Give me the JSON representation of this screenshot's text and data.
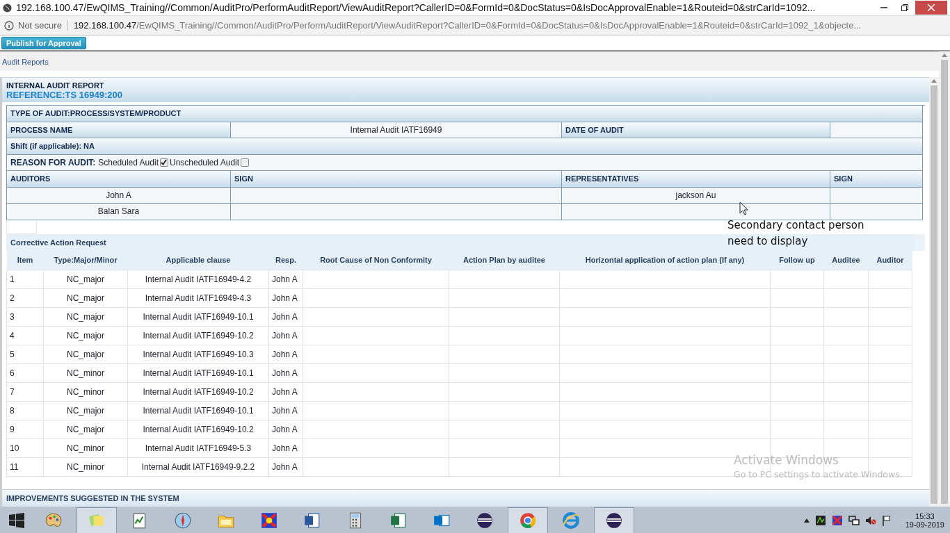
{
  "window": {
    "title": "192.168.100.47/EwQIMS_Training//Common/AuditPro/PerformAuditReport/ViewAuditReport?CallerID=0&FormId=0&DocStatus=0&IsDocApprovalEnable=1&Routeid=0&strCarId=1092..."
  },
  "address_bar": {
    "security": "Not secure",
    "host": "192.168.100.47",
    "path": "/EwQIMS_Training//Common/AuditPro/PerformAuditReport/ViewAuditReport?CallerID=0&FormId=0&DocStatus=0&IsDocApprovalEnable=1&Routeid=0&strCarId=1092_1&objecte..."
  },
  "toolbar": {
    "button": "Publish for Approval"
  },
  "breadcrumb": "Audit Reports",
  "report": {
    "title": "INTERNAL AUDIT REPORT",
    "reference": "REFERENCE:TS 16949:200",
    "type_of_audit": "TYPE OF AUDIT:PROCESS/SYSTEM/PRODUCT",
    "process_label": "PROCESS NAME",
    "process_value": "Internal Audit IATF16949",
    "date_label": "DATE OF AUDIT",
    "shift": "Shift (if applicable): NA",
    "reason_label": "REASON FOR AUDIT:",
    "reasons": [
      {
        "label": "Scheduled Audit",
        "checked": true
      },
      {
        "label": "Unscheduled Audit",
        "checked": false
      }
    ],
    "auditors_header": "AUDITORS",
    "auditor_sign_header": "SIGN",
    "representatives_header": "REPRESENTATIVES",
    "representative_sign_header": "SIGN",
    "people": [
      {
        "auditor": "John A",
        "representative": "jackson Au"
      },
      {
        "auditor": "Balan Sara"
      }
    ]
  },
  "car": {
    "title": "Corrective Action Request",
    "columns": [
      "Item",
      "Type:Major/Minor",
      "Applicable clause",
      "Resp.",
      "Root Cause of Non Conformity",
      "Action Plan by auditee",
      "Horizontal application of action plan (If any)",
      "Follow up",
      "Auditee",
      "Auditor"
    ],
    "rows": [
      [
        "1",
        "NC_major",
        "Internal Audit IATF16949-4.2",
        "John A"
      ],
      [
        "2",
        "NC_major",
        "Internal Audit IATF16949-4.3",
        "John A"
      ],
      [
        "3",
        "NC_major",
        "Internal Audit IATF16949-10.1",
        "John A"
      ],
      [
        "4",
        "NC_major",
        "Internal Audit IATF16949-10.2",
        "John A"
      ],
      [
        "5",
        "NC_major",
        "Internal Audit IATF16949-10.3",
        "John A"
      ],
      [
        "6",
        "NC_minor",
        "Internal Audit IATF16949-10.1",
        "John A"
      ],
      [
        "7",
        "NC_minor",
        "Internal Audit IATF16949-10.2",
        "John A"
      ],
      [
        "8",
        "NC_major",
        "Internal Audit IATF16949-10.1",
        "John A"
      ],
      [
        "9",
        "NC_major",
        "Internal Audit IATF16949-10.2",
        "John A"
      ],
      [
        "10",
        "NC_minor",
        "Internal Audit IATF16949-5.3",
        "John A"
      ],
      [
        "11",
        "NC_minor",
        "Internal Audit IATF16949-9.2.2",
        "John A"
      ]
    ]
  },
  "improvements": "IMPROVEMENTS SUGGESTED IN THE SYSTEM",
  "annotation": "Secondary contact person need to display",
  "activation": {
    "title": "Activate Windows",
    "subtitle": "Go to PC settings to activate Windows."
  },
  "taskbar": {
    "apps": [
      {
        "kind": "paint",
        "selected": false
      },
      {
        "kind": "notes",
        "selected": true
      },
      {
        "kind": "notepad",
        "selected": false
      },
      {
        "kind": "compass",
        "selected": false
      },
      {
        "kind": "folder",
        "selected": false
      },
      {
        "kind": "app",
        "selected": false
      },
      {
        "kind": "document",
        "selected": false
      },
      {
        "kind": "calculator",
        "selected": false
      },
      {
        "kind": "spreadsheet",
        "selected": false
      },
      {
        "kind": "mail",
        "selected": false
      },
      {
        "kind": "sphere",
        "selected": false
      },
      {
        "kind": "browser",
        "selected": true
      },
      {
        "kind": "globe",
        "selected": false
      },
      {
        "kind": "sphere",
        "selected": true
      }
    ],
    "time": "15:33",
    "date": "19-09-2019"
  }
}
